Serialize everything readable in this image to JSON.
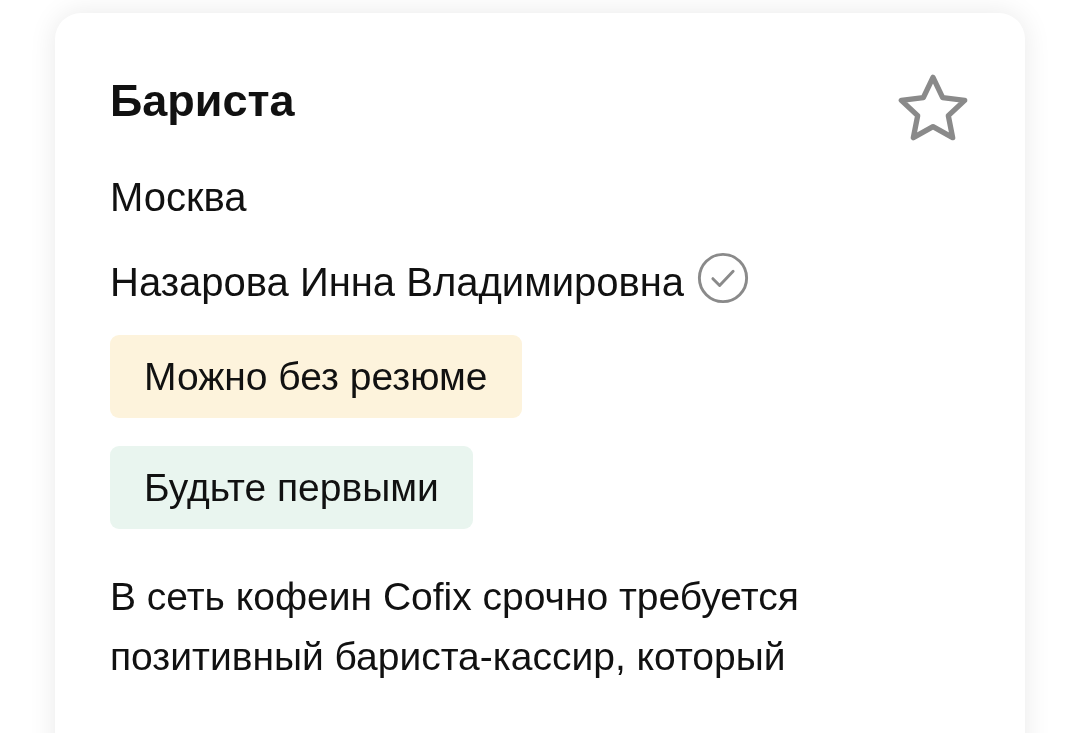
{
  "vacancy": {
    "title": "Бариста",
    "favorite": false,
    "city": "Москва",
    "employer": "Назарова Инна Владимировна",
    "verified": true,
    "tags": [
      {
        "label": "Можно без резюме",
        "color": "#fdf3dc"
      },
      {
        "label": "Будьте первыми",
        "color": "#e9f5ef"
      }
    ],
    "description": "В сеть кофеин Cofix срочно требуется позитивный бариста-кассир, который"
  }
}
